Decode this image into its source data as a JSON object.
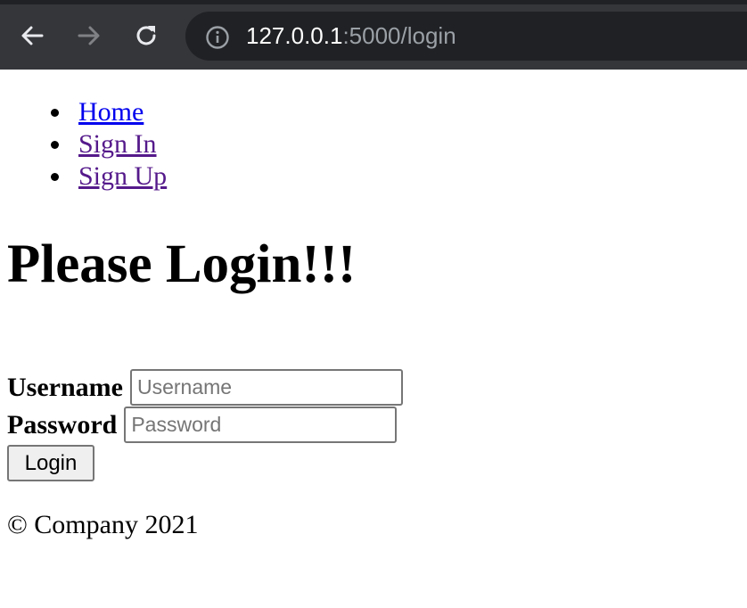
{
  "browser": {
    "url_host": "127.0.0.1",
    "url_rest": ":5000/login",
    "icons": [
      "back-arrow-icon",
      "forward-arrow-icon",
      "reload-icon",
      "info-icon"
    ]
  },
  "nav": {
    "items": [
      {
        "label": "Home"
      },
      {
        "label": "Sign In"
      },
      {
        "label": "Sign Up"
      }
    ]
  },
  "page": {
    "title": "Please Login!!!"
  },
  "form": {
    "username_label": "Username",
    "username_placeholder": "Username",
    "username_value": "",
    "password_label": "Password",
    "password_placeholder": "Password",
    "password_value": "",
    "submit_label": "Login"
  },
  "footer": {
    "text": "© Company 2021"
  },
  "colors": {
    "chrome_bg": "#35363a",
    "omnibox_bg": "#202124",
    "link": "#0000ee",
    "link_visited": "#551a8b"
  }
}
